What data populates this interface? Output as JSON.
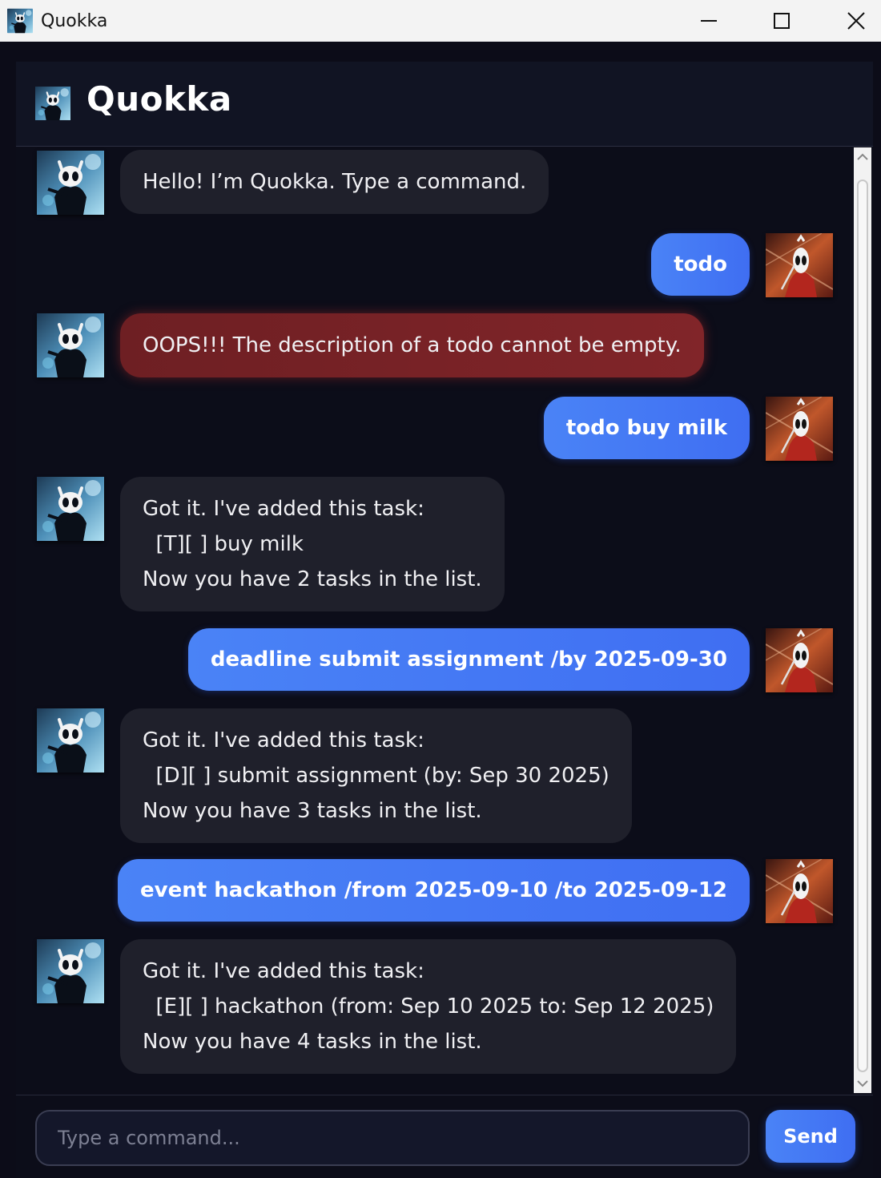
{
  "window": {
    "title": "Quokka",
    "icon": "knight-avatar-icon",
    "controls": [
      "minimize-icon",
      "maximize-icon",
      "close-icon"
    ]
  },
  "header": {
    "app_name": "Quokka",
    "logo": "knight-avatar-icon"
  },
  "colors": {
    "background": "#0c0c18",
    "bot_bubble": "#1f202b",
    "error_bubble": "#7a2327",
    "user_bubble": "#4679f4",
    "send_button": "#4679f4"
  },
  "messages": [
    {
      "sender": "bot",
      "avatar": "knight-avatar",
      "text": "Hello! I’m Quokka. Type a command."
    },
    {
      "sender": "user",
      "avatar": "hornet-avatar",
      "text": "todo"
    },
    {
      "sender": "bot",
      "avatar": "knight-avatar",
      "error": true,
      "text": "OOPS!!! The description of a todo cannot be empty."
    },
    {
      "sender": "user",
      "avatar": "hornet-avatar",
      "text": "todo buy milk"
    },
    {
      "sender": "bot",
      "avatar": "knight-avatar",
      "text": "Got it. I've added this task:\n  [T][ ] buy milk\nNow you have 2 tasks in the list."
    },
    {
      "sender": "user",
      "avatar": "hornet-avatar",
      "text": "deadline submit assignment /by 2025-09-30"
    },
    {
      "sender": "bot",
      "avatar": "knight-avatar",
      "text": "Got it. I've added this task:\n  [D][ ] submit assignment (by: Sep 30 2025)\nNow you have 3 tasks in the list."
    },
    {
      "sender": "user",
      "avatar": "hornet-avatar",
      "text": "event hackathon /from 2025-09-10 /to 2025-09-12"
    },
    {
      "sender": "bot",
      "avatar": "knight-avatar",
      "text": "Got it. I've added this task:\n  [E][ ] hackathon (from: Sep 10 2025 to: Sep 12 2025)\nNow you have 4 tasks in the list."
    }
  ],
  "input": {
    "placeholder": "Type a command...",
    "value": ""
  },
  "send_button": {
    "label": "Send"
  }
}
